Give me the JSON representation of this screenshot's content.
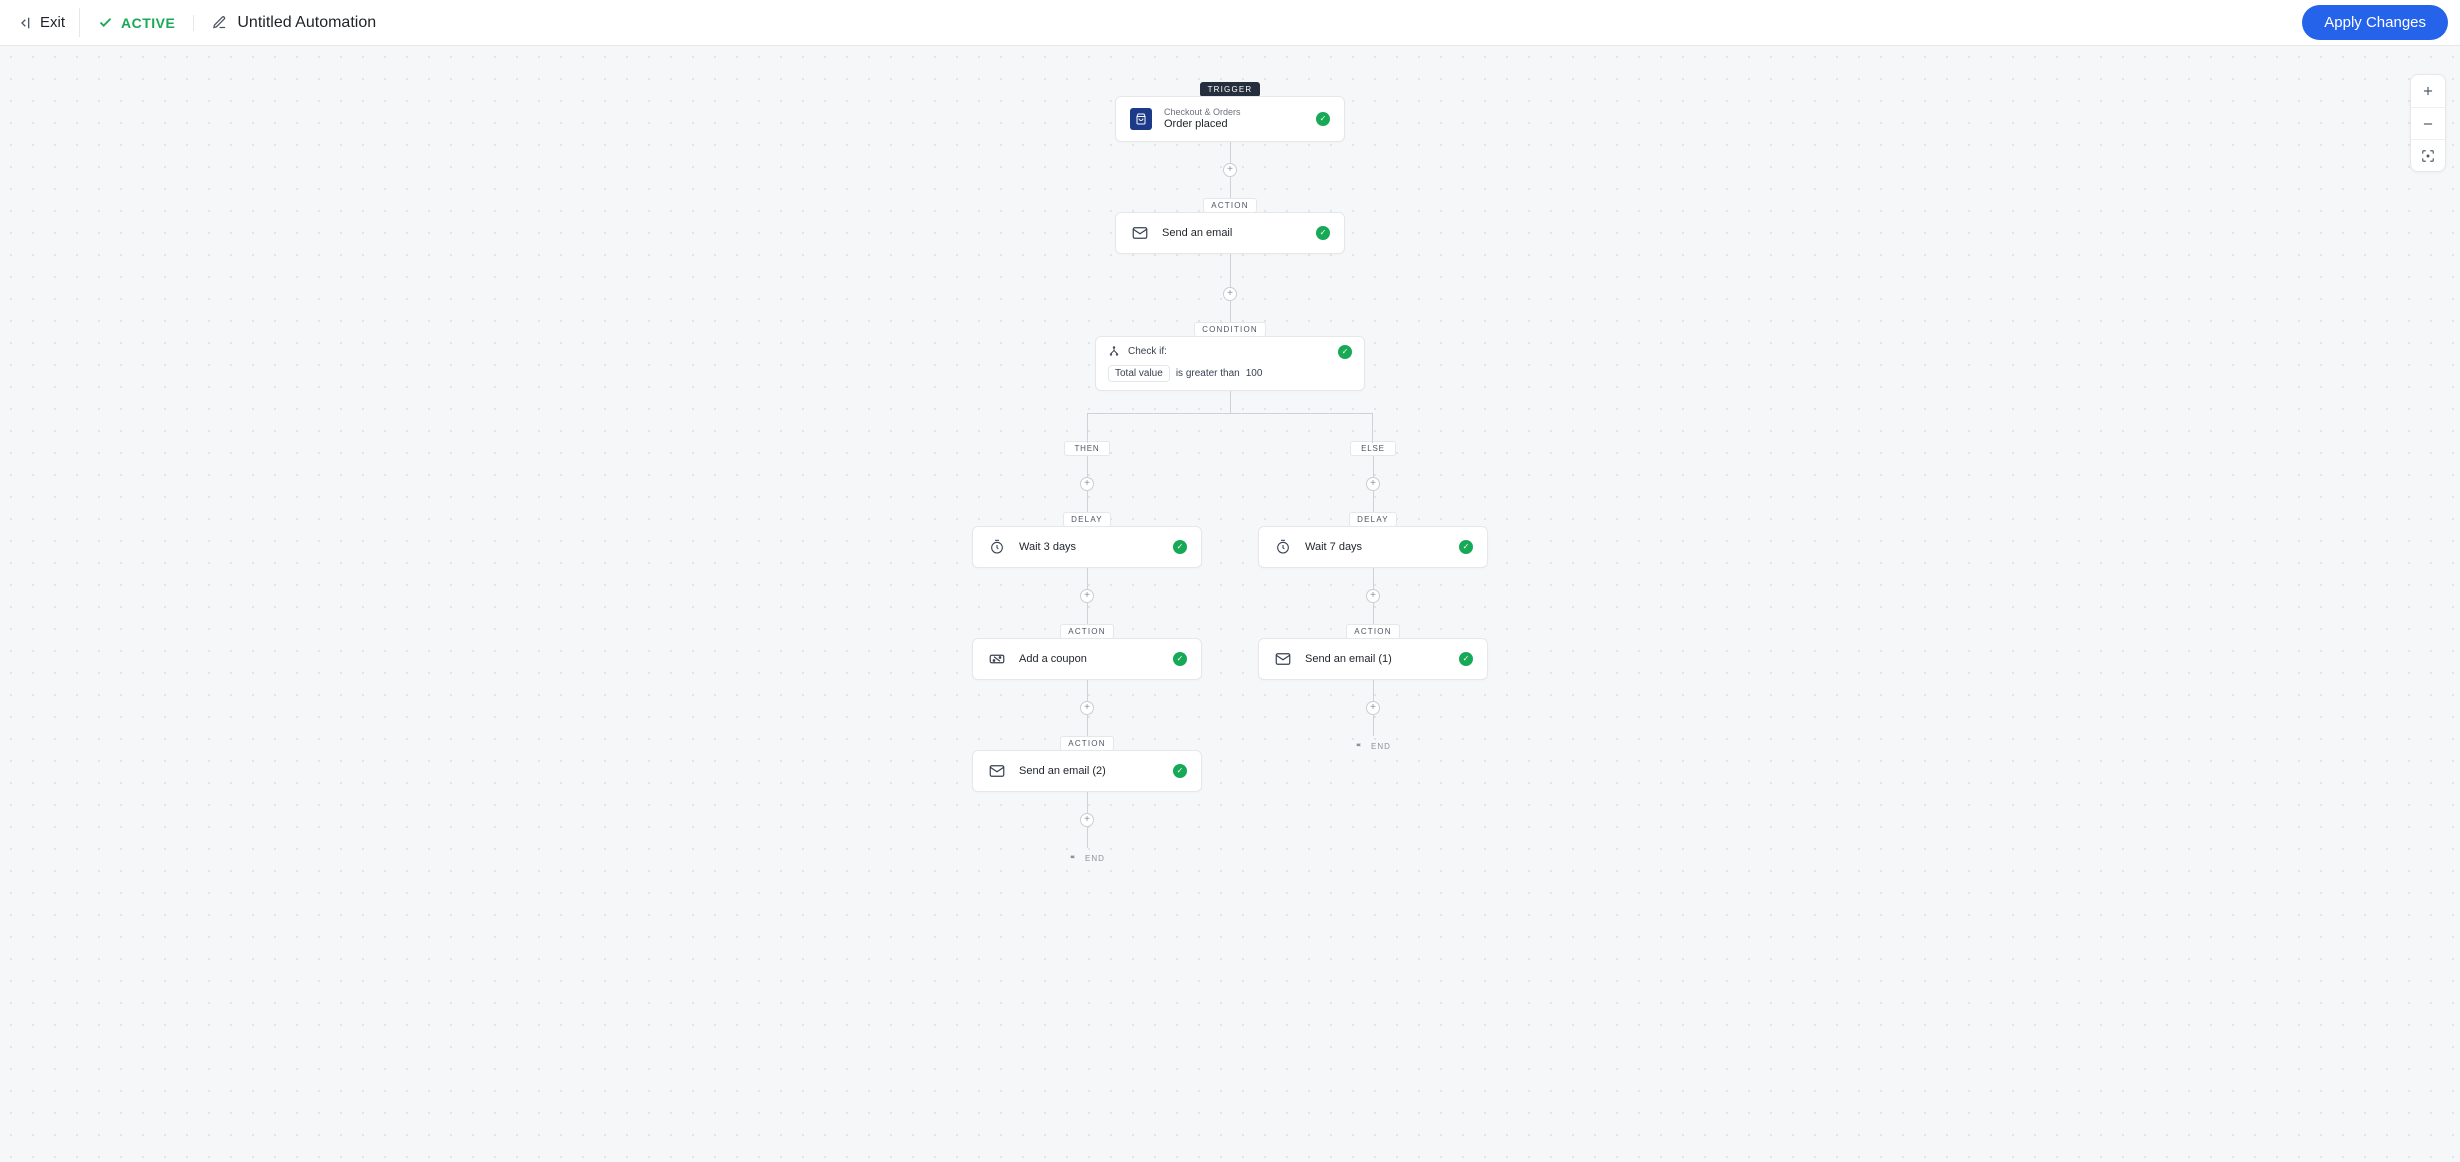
{
  "topbar": {
    "exit": "Exit",
    "status": "ACTIVE",
    "title": "Untitled Automation",
    "apply": "Apply Changes"
  },
  "labels": {
    "trigger": "TRIGGER",
    "action": "ACTION",
    "condition": "CONDITION",
    "delay": "DELAY",
    "then": "THEN",
    "else": "ELSE",
    "end": "END"
  },
  "trigger": {
    "category": "Checkout & Orders",
    "name": "Order placed"
  },
  "action1": {
    "name": "Send an email"
  },
  "condition": {
    "head": "Check if:",
    "field": "Total value",
    "operator": "is greater than",
    "value": "100"
  },
  "then": {
    "delay": "Wait 3 days",
    "action1": "Add a coupon",
    "action2": "Send an email (2)"
  },
  "else": {
    "delay": "Wait 7 days",
    "action1": "Send an email (1)"
  }
}
